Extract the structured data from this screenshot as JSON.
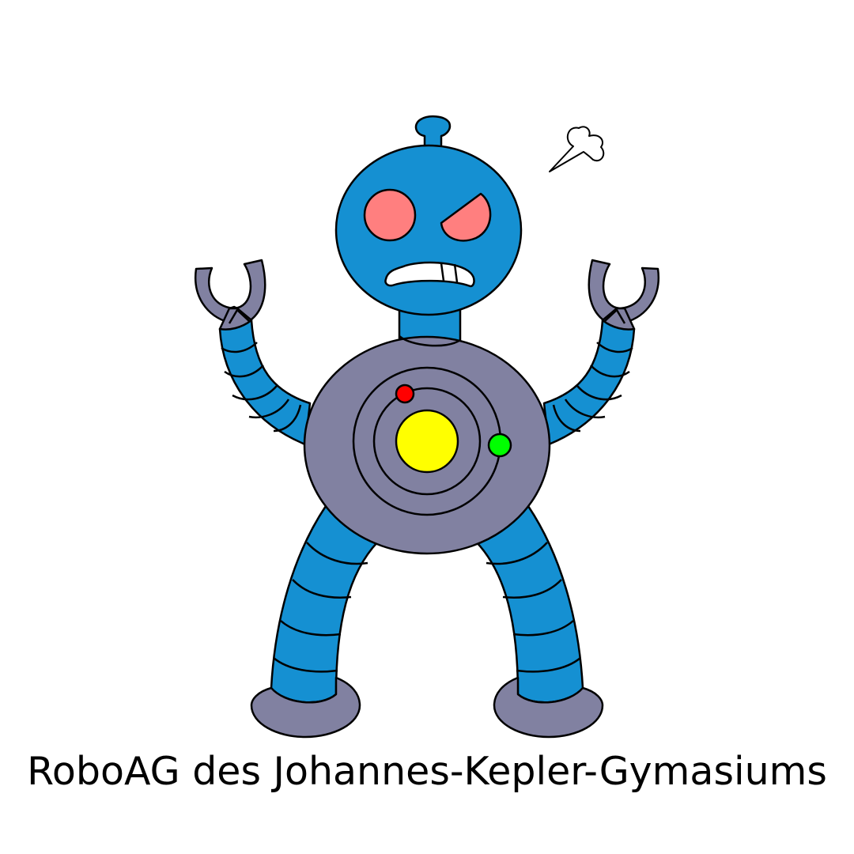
{
  "logo": {
    "name": "roboag-robot-mascot",
    "mood": "angry",
    "colors": {
      "body_blue": "#1590d2",
      "metal_gray": "#8181a1",
      "eye_red": "#ff7f7f",
      "core_yellow": "#ffff00",
      "led_red": "#ff0000",
      "led_green": "#00ff00",
      "outline": "#000000",
      "background": "#ffffff"
    }
  },
  "caption": "RoboAG des Johannes-Kepler-Gymasiums"
}
